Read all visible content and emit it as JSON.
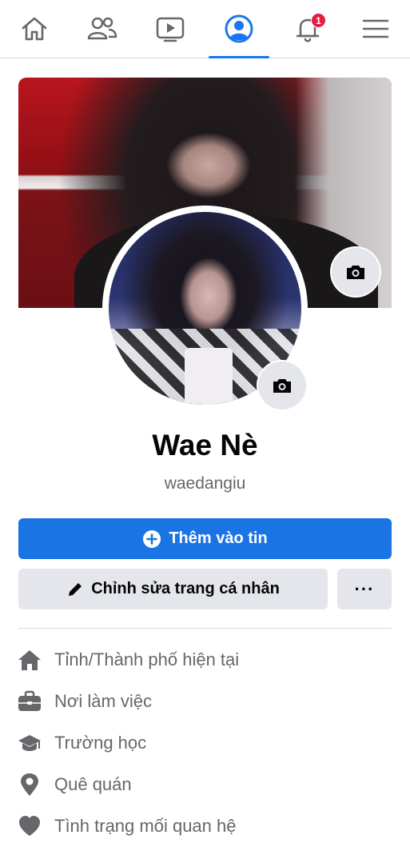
{
  "nav": {
    "tabs": [
      {
        "name": "home",
        "icon": "home-icon"
      },
      {
        "name": "friends",
        "icon": "friends-icon"
      },
      {
        "name": "watch",
        "icon": "video-icon"
      },
      {
        "name": "profile",
        "icon": "profile-icon",
        "active": true
      },
      {
        "name": "notifications",
        "icon": "bell-icon",
        "badge": "1"
      },
      {
        "name": "menu",
        "icon": "hamburger-icon"
      }
    ],
    "notification_badge": "1"
  },
  "profile": {
    "name": "Wae Nè",
    "username": "waedangiu"
  },
  "actions": {
    "add_story_label": "Thêm vào tin",
    "edit_profile_label": "Chỉnh sửa trang cá nhân",
    "more_label": "···"
  },
  "details": [
    {
      "icon": "home-icon",
      "label": "Tỉnh/Thành phố hiện tại"
    },
    {
      "icon": "briefcase-icon",
      "label": "Nơi làm việc"
    },
    {
      "icon": "graduation-cap-icon",
      "label": "Trường học"
    },
    {
      "icon": "location-pin-icon",
      "label": "Quê quán"
    },
    {
      "icon": "heart-icon",
      "label": "Tình trạng mối quan hệ"
    }
  ],
  "colors": {
    "accent": "#1877f2",
    "primary_button": "#1b74e4",
    "secondary_button": "#e4e6eb",
    "badge": "#e41e3f",
    "muted_text": "#65676b"
  }
}
